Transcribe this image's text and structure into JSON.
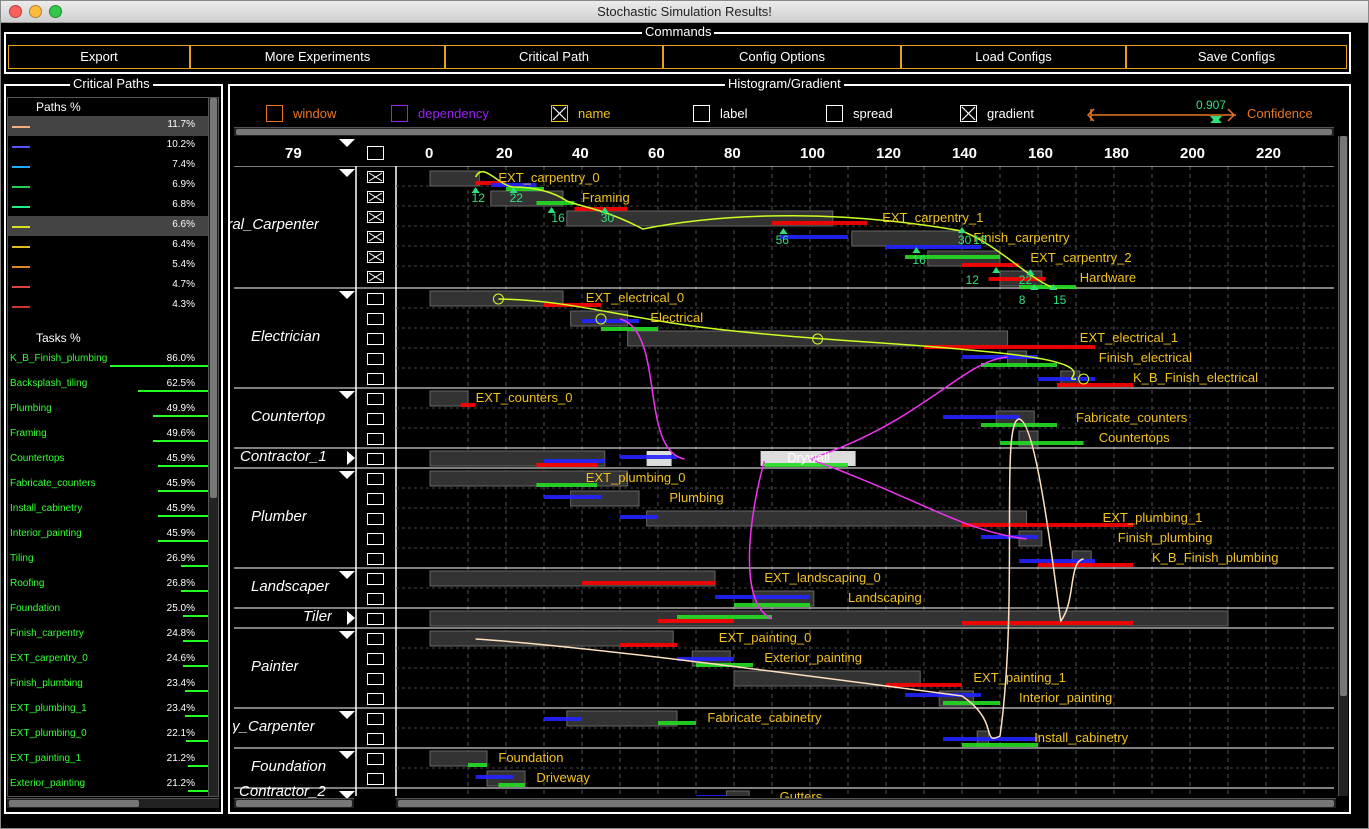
{
  "window": {
    "title": "Stochastic Simulation Results!"
  },
  "commands": {
    "legend": "Commands",
    "buttons": [
      "Export",
      "More Experiments",
      "Critical Path",
      "Config Options",
      "Load Configs",
      "Save Configs"
    ]
  },
  "critical_paths": {
    "legend": "Critical Paths",
    "paths_header": "Paths %",
    "paths": [
      {
        "pct": "11.7%",
        "color": "#f5b07a",
        "selected": true
      },
      {
        "pct": "10.2%",
        "color": "#5555ff",
        "selected": false
      },
      {
        "pct": "7.4%",
        "color": "#22aaff",
        "selected": false
      },
      {
        "pct": "6.9%",
        "color": "#22cc55",
        "selected": false
      },
      {
        "pct": "6.8%",
        "color": "#22ee88",
        "selected": false
      },
      {
        "pct": "6.6%",
        "color": "#dddd22",
        "selected": true
      },
      {
        "pct": "6.4%",
        "color": "#ddbb22",
        "selected": false
      },
      {
        "pct": "5.4%",
        "color": "#dd8822",
        "selected": false
      },
      {
        "pct": "4.7%",
        "color": "#dd4444",
        "selected": false
      },
      {
        "pct": "4.3%",
        "color": "#cc3333",
        "selected": false
      }
    ],
    "tasks_header": "Tasks %",
    "tasks": [
      {
        "name": "K_B_Finish_plumbing",
        "pct": "86.0%"
      },
      {
        "name": "Backsplash_tiling",
        "pct": "62.5%"
      },
      {
        "name": "Plumbing",
        "pct": "49.9%"
      },
      {
        "name": "Framing",
        "pct": "49.6%"
      },
      {
        "name": "Countertops",
        "pct": "45.9%"
      },
      {
        "name": "Fabricate_counters",
        "pct": "45.9%"
      },
      {
        "name": "Install_cabinetry",
        "pct": "45.9%"
      },
      {
        "name": "Interior_painting",
        "pct": "45.9%"
      },
      {
        "name": "Tiling",
        "pct": "26.9%"
      },
      {
        "name": "Roofing",
        "pct": "26.8%"
      },
      {
        "name": "Foundation",
        "pct": "25.0%"
      },
      {
        "name": "Finish_carpentry",
        "pct": "24.8%"
      },
      {
        "name": "EXT_carpentry_0",
        "pct": "24.6%"
      },
      {
        "name": "Finish_plumbing",
        "pct": "23.4%"
      },
      {
        "name": "EXT_plumbing_1",
        "pct": "23.4%"
      },
      {
        "name": "EXT_plumbing_0",
        "pct": "22.1%"
      },
      {
        "name": "EXT_painting_1",
        "pct": "21.2%"
      },
      {
        "name": "Exterior_painting",
        "pct": "21.2%"
      }
    ]
  },
  "histogram": {
    "legend": "Histogram/Gradient",
    "controls": [
      {
        "label": "window",
        "checked": false,
        "color": "#e8761f"
      },
      {
        "label": "dependency",
        "checked": false,
        "color": "#9922ee"
      },
      {
        "label": "name",
        "checked": true,
        "color": "#f3c21d"
      },
      {
        "label": "label",
        "checked": false,
        "color": "#ffffff"
      },
      {
        "label": "spread",
        "checked": false,
        "color": "#ffffff"
      },
      {
        "label": "gradient",
        "checked": true,
        "color": "#ffffff"
      }
    ],
    "confidence_value": "0.907",
    "confidence_label": "Confidence",
    "row_count": "79",
    "axis_ticks": [
      "0",
      "20",
      "40",
      "60",
      "80",
      "100",
      "120",
      "140",
      "160",
      "180",
      "200",
      "220"
    ],
    "rows": [
      {
        "label": "eral_Carpenter"
      },
      {
        "label": "Electrician"
      },
      {
        "label": "Countertop"
      },
      {
        "label": "Contractor_1"
      },
      {
        "label": "Plumber"
      },
      {
        "label": "Landscaper"
      },
      {
        "label": "Tiler"
      },
      {
        "label": "Painter"
      },
      {
        "label": "try_Carpenter"
      },
      {
        "label": "Foundation"
      },
      {
        "label": "Contractor_2"
      }
    ],
    "tasks": [
      "EXT_carpentry_0",
      "Framing",
      "EXT_carpentry_1",
      "Finish_carpentry",
      "EXT_carpentry_2",
      "Hardware",
      "EXT_electrical_0",
      "Electrical",
      "EXT_electrical_1",
      "Finish_electrical",
      "K_B_Finish_electrical",
      "EXT_counters_0",
      "Fabricate_counters",
      "Countertops",
      "Drywall",
      "EXT_plumbing_0",
      "Plumbing",
      "EXT_plumbing_1",
      "Finish_plumbing",
      "K_B_Finish_plumbing",
      "EXT_landscaping_0",
      "Landscaping",
      "EXT_painting_0",
      "Exterior_painting",
      "EXT_painting_1",
      "Interior_painting",
      "Fabricate_cabinetry",
      "Install_cabinetry",
      "Foundation",
      "Driveway",
      "Gutters"
    ],
    "numbers": [
      "12",
      "22",
      "16",
      "30",
      "56",
      "16",
      "30",
      "12",
      "22",
      "8",
      "15",
      "16"
    ]
  }
}
